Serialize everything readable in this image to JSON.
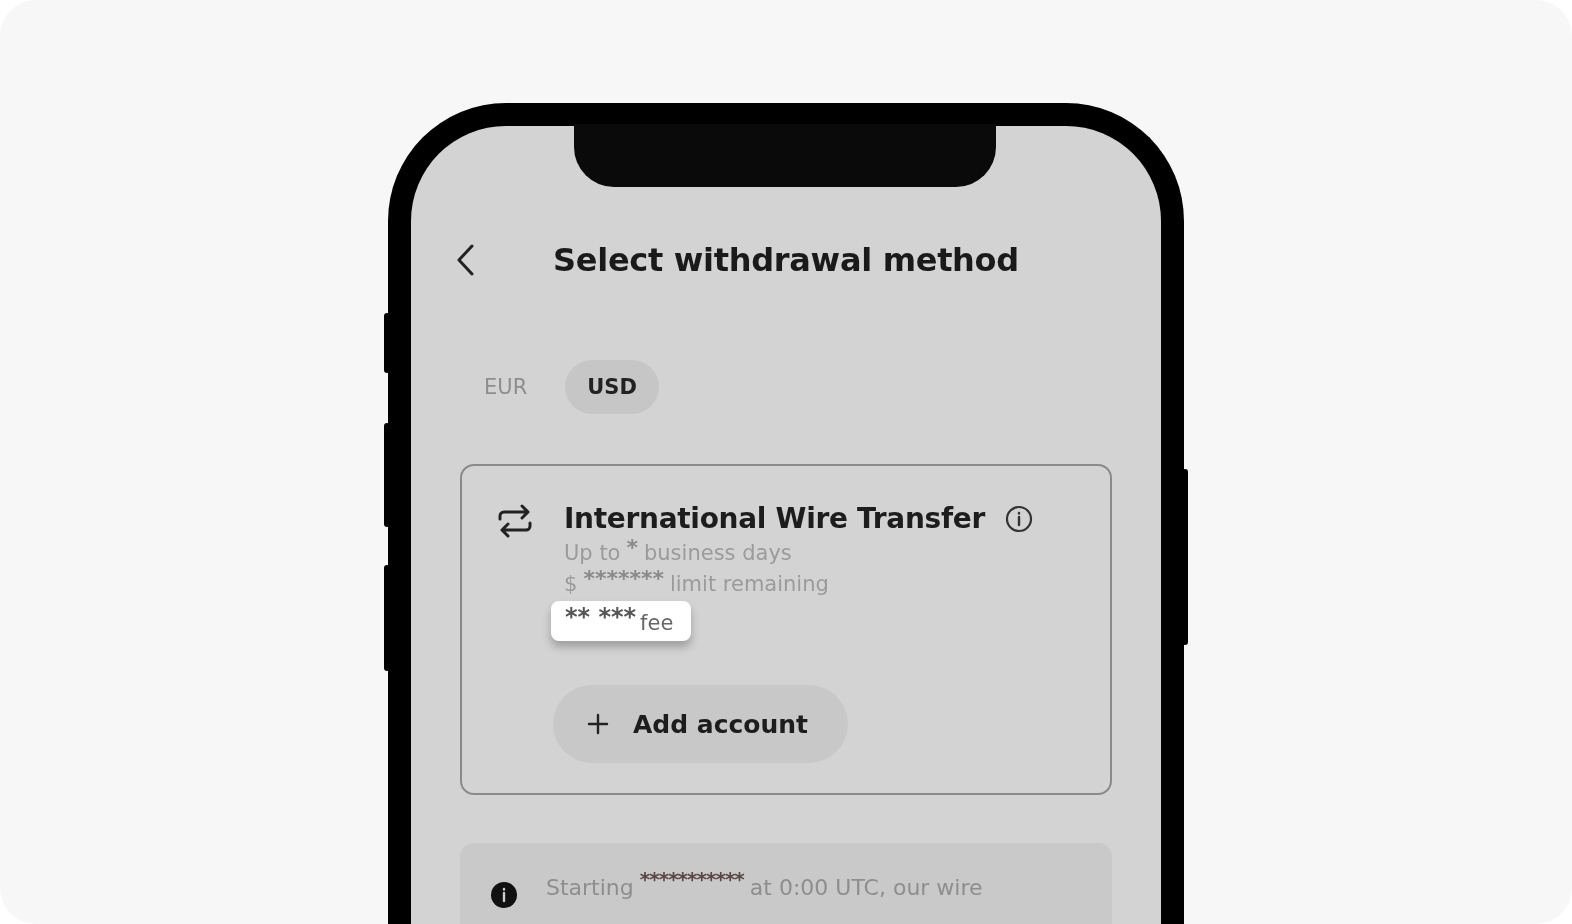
{
  "header": {
    "title": "Select withdrawal method"
  },
  "tabs": [
    {
      "label": "EUR",
      "selected": false
    },
    {
      "label": "USD",
      "selected": true
    }
  ],
  "method": {
    "title": "International Wire Transfer",
    "lines": [
      [
        {
          "text": "Up to",
          "raised": false
        },
        {
          "text": "*",
          "raised": true
        },
        {
          "text": "business days",
          "raised": false
        }
      ],
      [
        {
          "text": "$",
          "raised": false
        },
        {
          "text": "*******",
          "raised": true
        },
        {
          "text": "limit remaining",
          "raised": false
        }
      ]
    ],
    "fee": {
      "masked": "** ***",
      "label": "fee"
    },
    "button": "Add account"
  },
  "notice": [
    {
      "text": "Starting",
      "raised": false
    },
    {
      "text": "***********",
      "raised": true
    },
    {
      "text": "at 0:00 UTC, our wire",
      "raised": false
    }
  ]
}
